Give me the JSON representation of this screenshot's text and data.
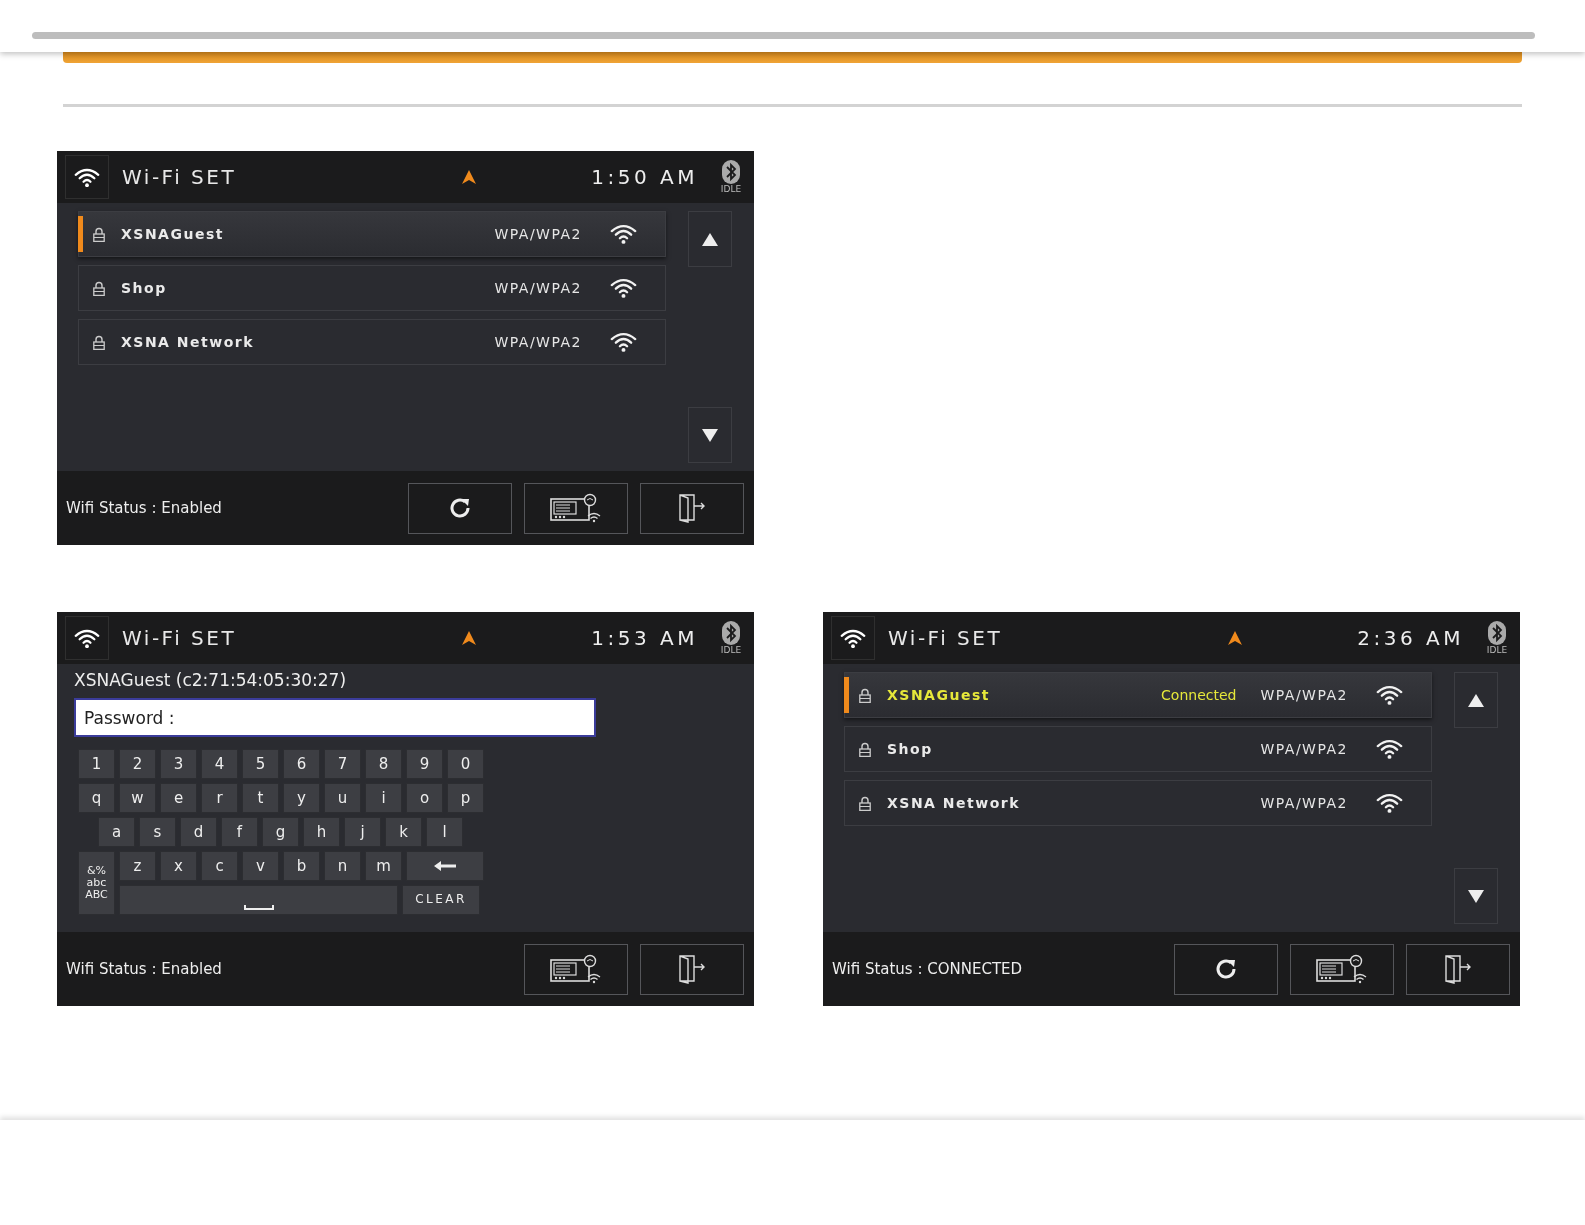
{
  "screens": [
    {
      "kind": "list",
      "title": "Wi-Fi SET",
      "time": "1:50 AM",
      "bt_state": "IDLE",
      "networks": [
        {
          "name": "XSNAGuest",
          "security": "WPA/WPA2",
          "selected": true
        },
        {
          "name": "Shop",
          "security": "WPA/WPA2",
          "selected": false
        },
        {
          "name": "XSNA Network",
          "security": "WPA/WPA2",
          "selected": false
        }
      ],
      "status": "Wifi Status : Enabled",
      "buttons": [
        {
          "kind": "refresh"
        },
        {
          "kind": "device"
        },
        {
          "kind": "exit"
        }
      ]
    },
    {
      "kind": "keyboard",
      "title": "Wi-Fi SET",
      "time": "1:53 AM",
      "bt_state": "IDLE",
      "network_label": "XSNAGuest (c2:71:54:05:30:27)",
      "password": {
        "placeholder": "Password :"
      },
      "keyboard": {
        "rows": [
          [
            "1",
            "2",
            "3",
            "4",
            "5",
            "6",
            "7",
            "8",
            "9",
            "0"
          ],
          [
            "q",
            "w",
            "e",
            "r",
            "t",
            "y",
            "u",
            "i",
            "o",
            "p"
          ],
          [
            "a",
            "s",
            "d",
            "f",
            "g",
            "h",
            "j",
            "k",
            "l"
          ]
        ],
        "letter_row_bottom": [
          "z",
          "x",
          "c",
          "v",
          "b",
          "n",
          "m"
        ],
        "mode_key": [
          "&%",
          "abc",
          "ABC"
        ],
        "clear": "CLEAR"
      },
      "status": "Wifi Status : Enabled",
      "buttons": [
        {
          "kind": "device"
        },
        {
          "kind": "exit"
        }
      ]
    },
    {
      "kind": "list",
      "title": "Wi-Fi SET",
      "time": "2:36 AM",
      "bt_state": "IDLE",
      "networks": [
        {
          "name": "XSNAGuest",
          "connection": "Connected",
          "security": "WPA/WPA2",
          "selected": true
        },
        {
          "name": "Shop",
          "security": "WPA/WPA2",
          "selected": false
        },
        {
          "name": "XSNA Network",
          "security": "WPA/WPA2",
          "selected": false
        }
      ],
      "status": "Wifi Status : CONNECTED",
      "buttons": [
        {
          "kind": "refresh"
        },
        {
          "kind": "device"
        },
        {
          "kind": "exit"
        }
      ]
    }
  ]
}
